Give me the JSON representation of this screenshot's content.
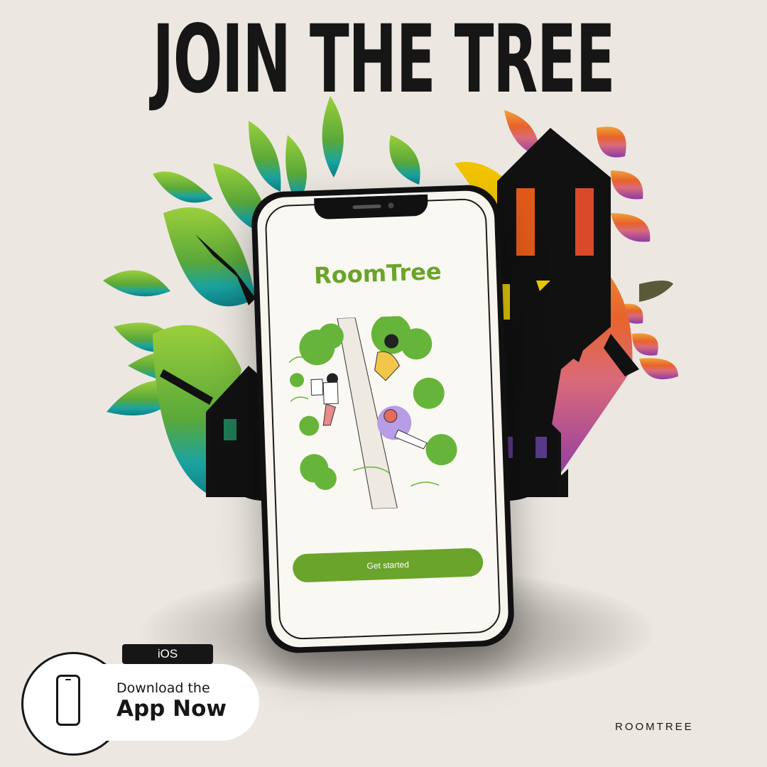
{
  "headline": "JOIN THE TREE",
  "phone": {
    "app_title": "RoomTree",
    "cta_label": "Get started"
  },
  "badge": {
    "platform": "iOS",
    "line1": "Download the",
    "line2": "App Now"
  },
  "brand": "ROOMTREE",
  "colors": {
    "background": "#ece8e1",
    "app_green": "#6aa42a",
    "ink": "#161616"
  },
  "icons": [
    "smartphone-icon"
  ]
}
